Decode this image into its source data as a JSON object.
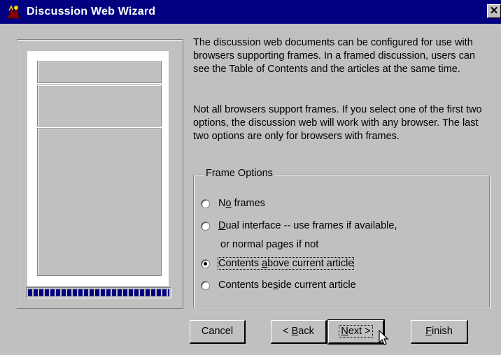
{
  "window": {
    "title": "Discussion Web Wizard",
    "close_glyph": "✕"
  },
  "description": {
    "para1": "The discussion web documents can be configured for use with browsers supporting frames. In a framed discussion, users can see the Table of Contents and the articles at the same time.",
    "para2": "Not all browsers support frames. If you select one of the first two options, the discussion web will work with any browser. The last two options are only for browsers with frames."
  },
  "frame_options": {
    "legend": "Frame Options",
    "options": [
      {
        "pre": "N",
        "key": "o",
        "post": " frames",
        "selected": false
      },
      {
        "pre": "",
        "key": "D",
        "post": "ual interface -- use frames if available,",
        "continuation": "or normal pages if not",
        "selected": false
      },
      {
        "pre": "Contents ",
        "key": "a",
        "post": "bove current article",
        "selected": true
      },
      {
        "pre": "Contents be",
        "key": "s",
        "post": "ide current article",
        "selected": false
      }
    ]
  },
  "preview": {
    "progress_fraction": 1.0
  },
  "buttons": {
    "cancel": {
      "pre": "Cancel",
      "key": "",
      "post": ""
    },
    "back": {
      "pre": "< ",
      "key": "B",
      "post": "ack"
    },
    "next": {
      "pre": "",
      "key": "N",
      "post": "ext >"
    },
    "finish": {
      "pre": "",
      "key": "F",
      "post": "inish"
    }
  },
  "icons": {
    "app": "wizard-app-icon",
    "close": "close-icon",
    "cursor": "mouse-pointer-icon"
  },
  "colors": {
    "titlebar": "#000080",
    "face": "#c0c0c0",
    "progress": "#000080"
  }
}
